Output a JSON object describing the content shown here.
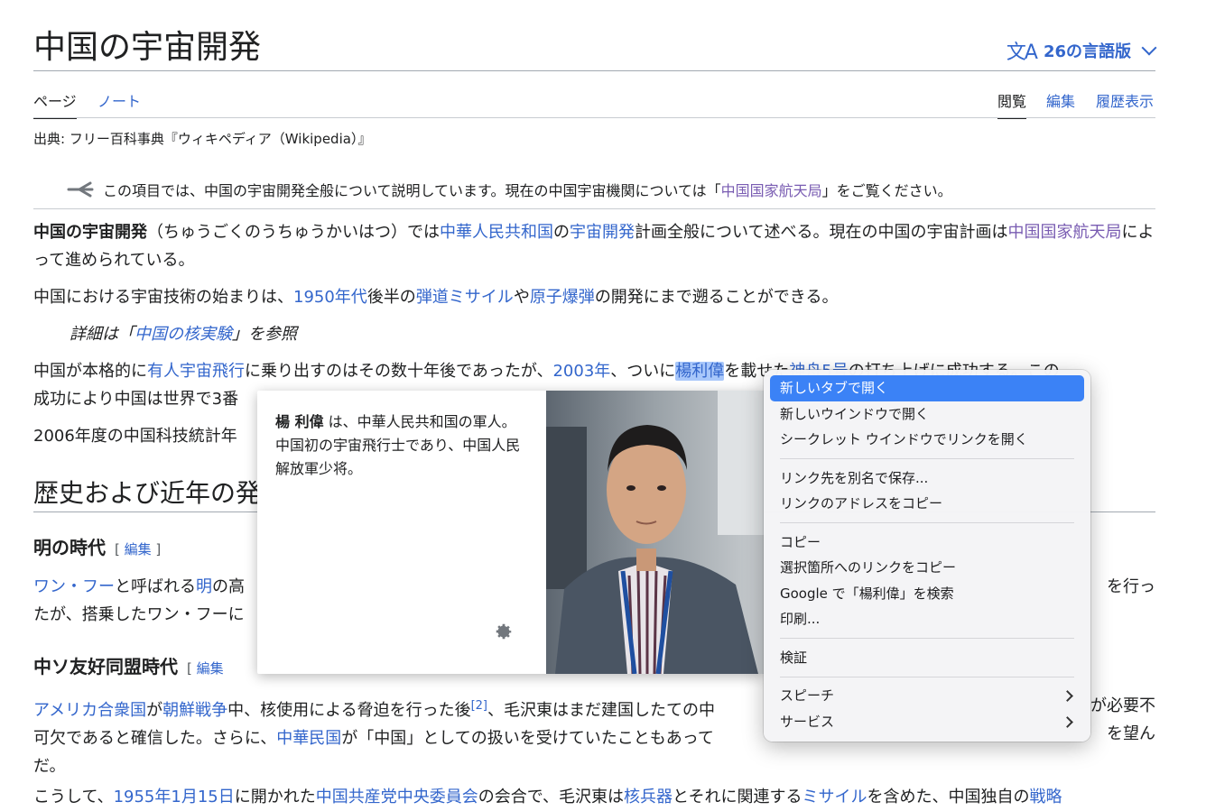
{
  "header": {
    "title": "中国の宇宙開発",
    "lang_icon": "文A",
    "lang_label": "26の言語版"
  },
  "tabs": {
    "page": "ページ",
    "note": "ノート",
    "read": "閲覧",
    "edit": "編集",
    "history": "履歴表示"
  },
  "from_line": "出典: フリー百科事典『ウィキペディア（Wikipedia）』",
  "hatnote": {
    "icon": "disambiguation-icon",
    "pre": "この項目では、中国の宇宙開発全般について説明しています。現在の中国宇宙機関については「",
    "link": "中国国家航天局",
    "post": "」をご覧ください。"
  },
  "intro": {
    "bold": "中国の宇宙開発",
    "t1": "（ちゅうごくのうちゅうかいはつ）では",
    "l1": "中華人民共和国",
    "t2": "の",
    "l2": "宇宙開発",
    "t3": "計画全般について述べる。現在の中国の宇宙計画は",
    "l3": "中国国家航天局",
    "t4": "によって進められている。"
  },
  "para2": {
    "t1": "中国における宇宙技術の始まりは、",
    "l1": "1950年代",
    "t2": "後半の",
    "l2": "弾道ミサイル",
    "t3": "や",
    "l3": "原子爆弾",
    "t4": "の開発にまで遡ることができる。"
  },
  "see_also": {
    "pre": "詳細は「",
    "link": "中国の核実験",
    "post": "」を参照"
  },
  "para3": {
    "t1": "中国が本格的に",
    "l1": "有人宇宙飛行",
    "t2": "に乗り出すのはその数十年後であったが、",
    "l2": "2003年",
    "t3": "、ついに",
    "l3": "楊利偉",
    "t4": "を載せた",
    "l4": "神舟5号",
    "t5": "の打ち上げに成功する。この",
    "line2": "成功により中国は世界で3番"
  },
  "para4": "2006年度の中国科技統計年",
  "section_history": "歴史および近年の発",
  "section_ming": {
    "title": "明の時代",
    "edit": "編集"
  },
  "ming_para": {
    "l1": "ワン・フー",
    "t1": "と呼ばれる",
    "l2": "明",
    "t2": "の高",
    "tail": "を行っ",
    "line2": "たが、搭乗したワン・フーに"
  },
  "section_sino": {
    "title": "中ソ友好同盟時代",
    "edit": "編集"
  },
  "sino_para": {
    "l1": "アメリカ合衆国",
    "t1": "が",
    "l2": "朝鮮戦争",
    "t2": "中、核使用による脅迫を行った後",
    "ref": "[2]",
    "t3": "、毛沢東はまだ建国したての中",
    "tail1": "が必要不",
    "line2a": "可欠であると確信した。さらに、",
    "l3": "中華民国",
    "line2b": "が「中国」としての扱いを受けていたこともあって",
    "tail2": "を望ん",
    "line3": "だ。",
    "line4a": "こうして、",
    "l4": "1955年1月15日",
    "line4b": "に開かれた",
    "l5": "中国共産党中央委員会",
    "line4c": "の会合で、毛沢東は",
    "l6": "核兵器",
    "line4d": "とそれに関連する",
    "l7": "ミサイル",
    "line4e": "を含めた、中国独自の",
    "l8": "戦略"
  },
  "popup": {
    "name": "楊 利偉",
    "desc": " は、中華人民共和国の軍人。中国初の宇宙飛行士であり、中国人民解放軍少将。",
    "gear_icon": "gear-icon"
  },
  "context_menu": {
    "items": [
      "新しいタブで開く",
      "新しいウインドウで開く",
      "シークレット ウインドウでリンクを開く",
      "リンク先を別名で保存...",
      "リンクのアドレスをコピー",
      "コピー",
      "選択箇所へのリンクをコピー",
      "Google で「楊利偉」を検索",
      "印刷...",
      "検証",
      "スピーチ",
      "サービス"
    ]
  },
  "colors": {
    "link": "#3366cc",
    "visited": "#795cb2",
    "menu_highlight": "#3b82f6"
  }
}
